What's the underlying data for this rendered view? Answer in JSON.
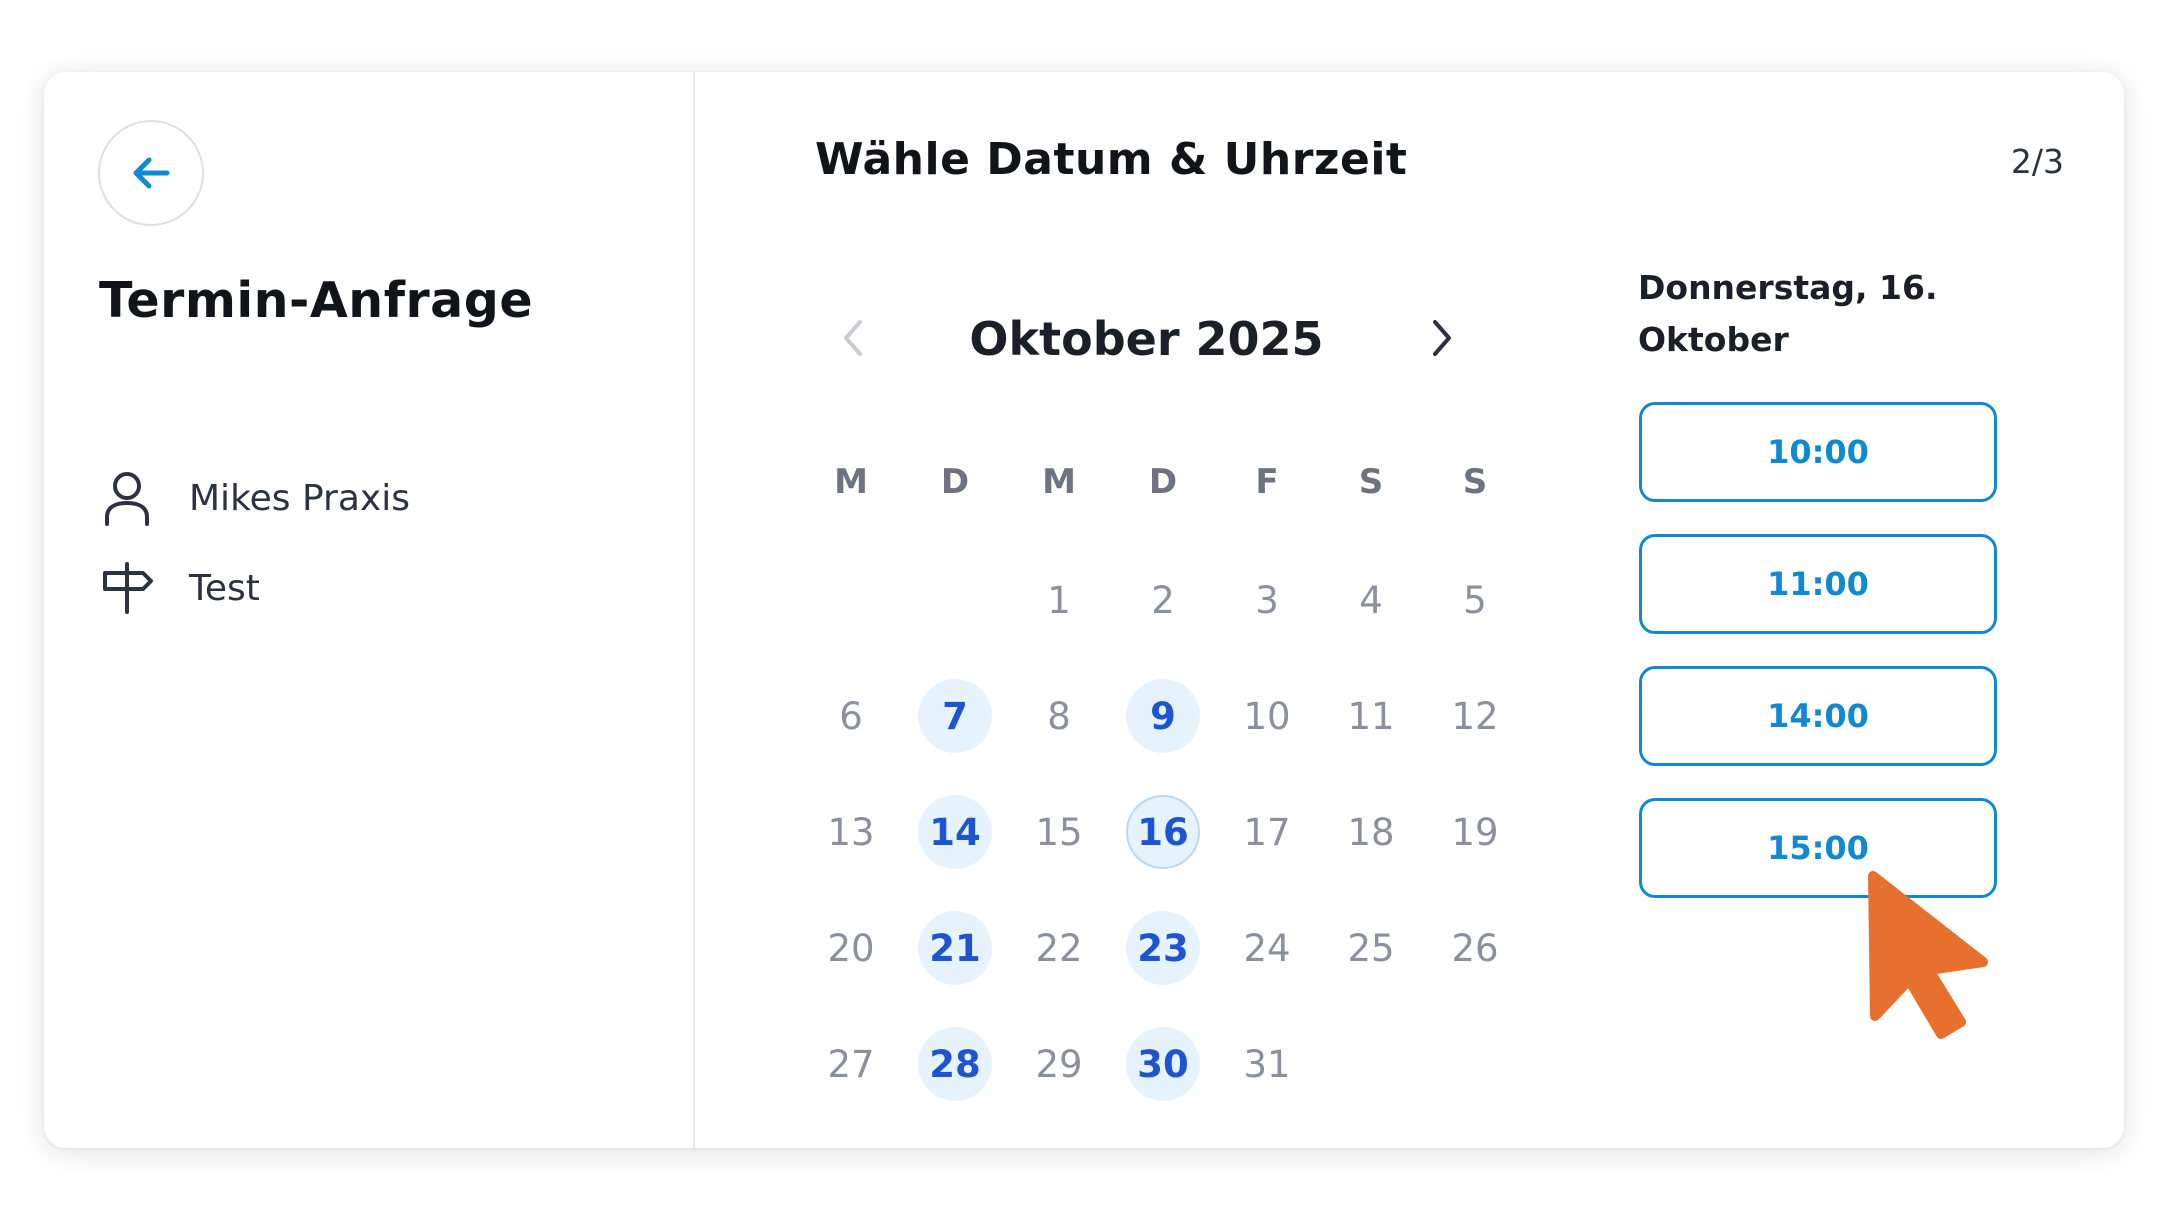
{
  "sidebar": {
    "back_icon": "arrow-left-icon",
    "title": "Termin-Anfrage",
    "practice": {
      "icon": "user-icon",
      "label": "Mikes Praxis"
    },
    "service": {
      "icon": "signpost-icon",
      "label": "Test"
    }
  },
  "header": {
    "title": "Wähle Datum & Uhrzeit",
    "step": "2/3"
  },
  "calendar": {
    "month_label": "Oktober 2025",
    "prev_icon": "chevron-left-icon",
    "next_icon": "chevron-right-icon",
    "weekdays": [
      "M",
      "D",
      "M",
      "D",
      "F",
      "S",
      "S"
    ],
    "leading_blanks": 2,
    "days": [
      {
        "label": "1",
        "available": false
      },
      {
        "label": "2",
        "available": false
      },
      {
        "label": "3",
        "available": false
      },
      {
        "label": "4",
        "available": false
      },
      {
        "label": "5",
        "available": false
      },
      {
        "label": "6",
        "available": false
      },
      {
        "label": "7",
        "available": true
      },
      {
        "label": "8",
        "available": false
      },
      {
        "label": "9",
        "available": true
      },
      {
        "label": "10",
        "available": false
      },
      {
        "label": "11",
        "available": false
      },
      {
        "label": "12",
        "available": false
      },
      {
        "label": "13",
        "available": false
      },
      {
        "label": "14",
        "available": true
      },
      {
        "label": "15",
        "available": false
      },
      {
        "label": "16",
        "available": true,
        "selected": true
      },
      {
        "label": "17",
        "available": false
      },
      {
        "label": "18",
        "available": false
      },
      {
        "label": "19",
        "available": false
      },
      {
        "label": "20",
        "available": false
      },
      {
        "label": "21",
        "available": true
      },
      {
        "label": "22",
        "available": false
      },
      {
        "label": "23",
        "available": true
      },
      {
        "label": "24",
        "available": false
      },
      {
        "label": "25",
        "available": false
      },
      {
        "label": "26",
        "available": false
      },
      {
        "label": "27",
        "available": false
      },
      {
        "label": "28",
        "available": true
      },
      {
        "label": "29",
        "available": false
      },
      {
        "label": "30",
        "available": true
      },
      {
        "label": "31",
        "available": false
      }
    ]
  },
  "slots_panel": {
    "date_heading": "Donnerstag, 16. Oktober",
    "times": [
      "10:00",
      "11:00",
      "14:00",
      "15:00"
    ]
  },
  "colors": {
    "accent": "#0f8ad2",
    "available_day_bg": "#e6f3fd",
    "available_day_text": "#1f54d1",
    "cursor": "#e8702f"
  },
  "pointer": {
    "icon": "mouse-pointer-icon"
  }
}
